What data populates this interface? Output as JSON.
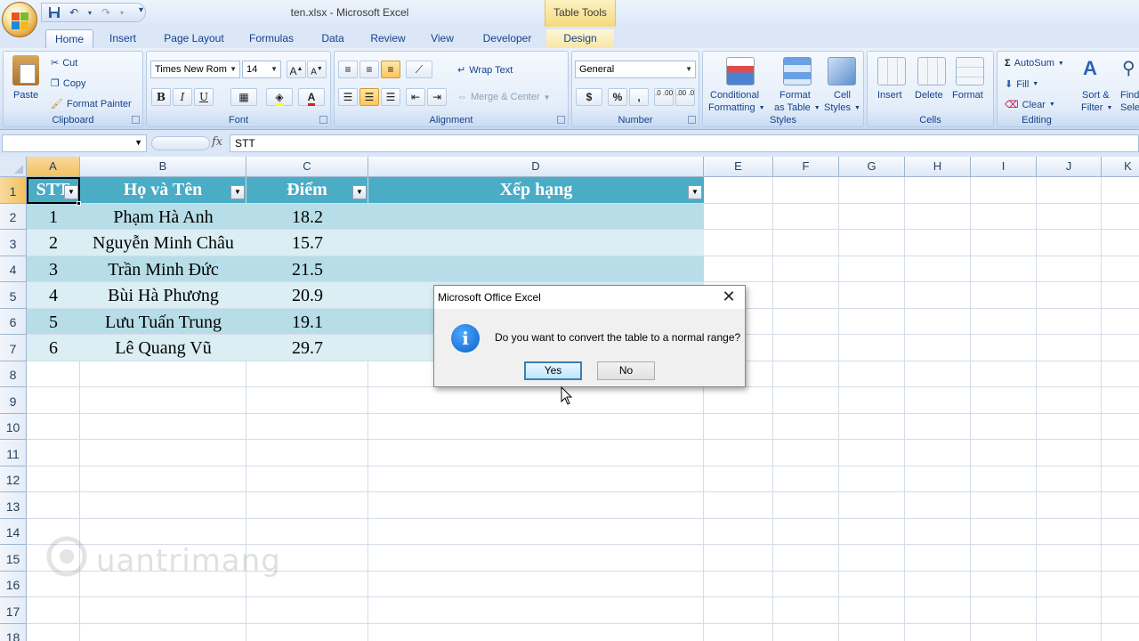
{
  "app": {
    "window_title": "ten.xlsx - Microsoft Excel",
    "contextual_tab_group": "Table Tools"
  },
  "tabs": [
    "Home",
    "Insert",
    "Page Layout",
    "Formulas",
    "Data",
    "Review",
    "View",
    "Developer",
    "Design"
  ],
  "ribbon": {
    "clipboard": {
      "label": "Clipboard",
      "paste": "Paste",
      "cut": "Cut",
      "copy": "Copy",
      "format_painter": "Format Painter"
    },
    "font": {
      "label": "Font",
      "font_name": "Times New Rom",
      "font_size": "14",
      "bold": "B",
      "italic": "I",
      "underline": "U"
    },
    "alignment": {
      "label": "Alignment",
      "wrap_text": "Wrap Text",
      "merge_center": "Merge & Center"
    },
    "number": {
      "label": "Number",
      "format": "General",
      "currency": "$",
      "percent": "%",
      "comma": ",",
      "inc_dec": ".0 .00",
      "dec_dec": ".00 .0"
    },
    "styles": {
      "label": "Styles",
      "conditional_1": "Conditional",
      "conditional_2": "Formatting",
      "format_table_1": "Format",
      "format_table_2": "as Table",
      "cell_styles_1": "Cell",
      "cell_styles_2": "Styles"
    },
    "cells": {
      "label": "Cells",
      "insert": "Insert",
      "delete": "Delete",
      "format": "Format"
    },
    "editing": {
      "label": "Editing",
      "autosum": "AutoSum",
      "fill": "Fill",
      "clear": "Clear",
      "sort_1": "Sort &",
      "sort_2": "Filter",
      "find_1": "Find",
      "find_2": "Sele"
    }
  },
  "formula_bar": {
    "name_box": "",
    "fx": "fx",
    "content": "STT"
  },
  "columns": [
    "A",
    "B",
    "C",
    "D",
    "E",
    "F",
    "G",
    "H",
    "I",
    "J",
    "K"
  ],
  "rows": [
    "1",
    "2",
    "3",
    "4",
    "5",
    "6",
    "7",
    "8",
    "9",
    "10",
    "11",
    "12",
    "13",
    "14",
    "15",
    "16",
    "17",
    "18"
  ],
  "table": {
    "headers": [
      "STT",
      "Họ và Tên",
      "Điểm",
      "Xếp hạng"
    ],
    "rows": [
      [
        "1",
        "Phạm Hà Anh",
        "18.2",
        ""
      ],
      [
        "2",
        "Nguyễn Minh Châu",
        "15.7",
        ""
      ],
      [
        "3",
        "Trần Minh Đức",
        "21.5",
        ""
      ],
      [
        "4",
        "Bùi Hà Phương",
        "20.9",
        ""
      ],
      [
        "5",
        "Lưu Tuấn Trung",
        "19.1",
        ""
      ],
      [
        "6",
        "Lê Quang Vũ",
        "29.7",
        ""
      ]
    ],
    "header_color": "#4bacc6",
    "band_dark": "#b7dee8",
    "band_light": "#dbeef3"
  },
  "dialog": {
    "title": "Microsoft Office Excel",
    "message": "Do you want to convert the table to a normal range?",
    "yes": "Yes",
    "no": "No",
    "icon": "info-icon"
  },
  "watermark": "uantrimang"
}
